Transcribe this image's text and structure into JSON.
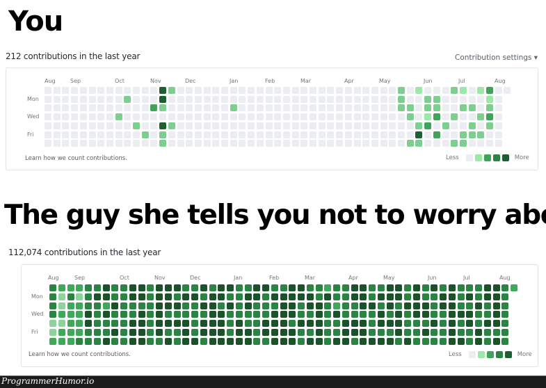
{
  "captions": {
    "top": "You",
    "bottom": "The guy she tells you not to worry about"
  },
  "palette": {
    "level0": "#ebedf0",
    "level1": "#9be9a8",
    "level2": "#7dcf8f",
    "level3": "#40a35a",
    "level4": "#1e5e31",
    "dense1": "#8fd39c",
    "dense2": "#3fa85a",
    "dense3": "#2b8444",
    "dense4": "#1b5229"
  },
  "profile1": {
    "count_text": "212 contributions in the last year",
    "settings_label": "Contribution settings ▾",
    "months": [
      "Aug",
      "Sep",
      "Oct",
      "Nov",
      "Dec",
      "Jan",
      "Feb",
      "Mar",
      "Apr",
      "May",
      "Jun",
      "Jul",
      "Aug"
    ],
    "weekdays": [
      "Mon",
      "Wed",
      "Fri"
    ],
    "learn_text": "Learn how we count contributions.",
    "legend_less": "Less",
    "legend_more": "More"
  },
  "profile2": {
    "count_text": "112,074 contributions in the last year",
    "months": [
      "Aug",
      "Sep",
      "Oct",
      "Nov",
      "Dec",
      "Jan",
      "Feb",
      "Mar",
      "Apr",
      "May",
      "Jun",
      "Jul",
      "Aug"
    ],
    "weekdays": [
      "Mon",
      "Wed",
      "Fri"
    ],
    "learn_text": "Learn how we count contributions.",
    "legend_less": "Less",
    "legend_more": "More"
  },
  "watermark": "ProgrammerHumor.io",
  "chart_data": [
    {
      "type": "heatmap",
      "title": "212 contributions in the last year",
      "x_tick_labels": [
        "Aug",
        "Sep",
        "Oct",
        "Nov",
        "Dec",
        "Jan",
        "Feb",
        "Mar",
        "Apr",
        "May",
        "Jun",
        "Jul",
        "Aug"
      ],
      "y_tick_labels": [
        "Mon",
        "Wed",
        "Fri"
      ],
      "rows": [
        "Sun",
        "Mon",
        "Tue",
        "Wed",
        "Thu",
        "Fri",
        "Sat"
      ],
      "weeks": 53,
      "levels_legend": [
        "Less",
        "More"
      ],
      "nonzero_cells": [
        {
          "row": 0,
          "week": 13,
          "level": 4
        },
        {
          "row": 0,
          "week": 14,
          "level": 2
        },
        {
          "row": 0,
          "week": 40,
          "level": 2
        },
        {
          "row": 0,
          "week": 42,
          "level": 1
        },
        {
          "row": 0,
          "week": 46,
          "level": 2
        },
        {
          "row": 0,
          "week": 47,
          "level": 1
        },
        {
          "row": 0,
          "week": 49,
          "level": 1
        },
        {
          "row": 0,
          "week": 50,
          "level": 3
        },
        {
          "row": 1,
          "week": 9,
          "level": 2
        },
        {
          "row": 1,
          "week": 13,
          "level": 4
        },
        {
          "row": 1,
          "week": 40,
          "level": 2
        },
        {
          "row": 1,
          "week": 43,
          "level": 2
        },
        {
          "row": 1,
          "week": 44,
          "level": 2
        },
        {
          "row": 1,
          "week": 50,
          "level": 1
        },
        {
          "row": 2,
          "week": 12,
          "level": 3
        },
        {
          "row": 2,
          "week": 13,
          "level": 2
        },
        {
          "row": 2,
          "week": 21,
          "level": 2
        },
        {
          "row": 2,
          "week": 40,
          "level": 2
        },
        {
          "row": 2,
          "week": 41,
          "level": 2
        },
        {
          "row": 2,
          "week": 43,
          "level": 2
        },
        {
          "row": 2,
          "week": 44,
          "level": 2
        },
        {
          "row": 2,
          "week": 47,
          "level": 2
        },
        {
          "row": 2,
          "week": 48,
          "level": 2
        },
        {
          "row": 2,
          "week": 50,
          "level": 2
        },
        {
          "row": 3,
          "week": 8,
          "level": 2
        },
        {
          "row": 3,
          "week": 41,
          "level": 2
        },
        {
          "row": 3,
          "week": 43,
          "level": 1
        },
        {
          "row": 3,
          "week": 44,
          "level": 3
        },
        {
          "row": 3,
          "week": 46,
          "level": 2
        },
        {
          "row": 3,
          "week": 49,
          "level": 2
        },
        {
          "row": 3,
          "week": 50,
          "level": 3
        },
        {
          "row": 4,
          "week": 10,
          "level": 2
        },
        {
          "row": 4,
          "week": 13,
          "level": 4
        },
        {
          "row": 4,
          "week": 14,
          "level": 2
        },
        {
          "row": 4,
          "week": 42,
          "level": 2
        },
        {
          "row": 4,
          "week": 43,
          "level": 3
        },
        {
          "row": 4,
          "week": 45,
          "level": 2
        },
        {
          "row": 4,
          "week": 48,
          "level": 2
        },
        {
          "row": 4,
          "week": 50,
          "level": 2
        },
        {
          "row": 5,
          "week": 11,
          "level": 2
        },
        {
          "row": 5,
          "week": 13,
          "level": 2
        },
        {
          "row": 5,
          "week": 42,
          "level": 4
        },
        {
          "row": 5,
          "week": 44,
          "level": 3
        },
        {
          "row": 5,
          "week": 47,
          "level": 2
        },
        {
          "row": 5,
          "week": 48,
          "level": 2
        },
        {
          "row": 5,
          "week": 49,
          "level": 2
        },
        {
          "row": 6,
          "week": 13,
          "level": 2
        },
        {
          "row": 6,
          "week": 41,
          "level": 2
        },
        {
          "row": 6,
          "week": 42,
          "level": 2
        },
        {
          "row": 6,
          "week": 46,
          "level": 2
        },
        {
          "row": 6,
          "week": 47,
          "level": 2
        }
      ]
    },
    {
      "type": "heatmap",
      "title": "112,074 contributions in the last year",
      "x_tick_labels": [
        "Aug",
        "Sep",
        "Oct",
        "Nov",
        "Dec",
        "Jan",
        "Feb",
        "Mar",
        "Apr",
        "May",
        "Jun",
        "Jul",
        "Aug"
      ],
      "y_tick_labels": [
        "Mon",
        "Wed",
        "Fri"
      ],
      "rows": [
        "Sun",
        "Mon",
        "Tue",
        "Wed",
        "Thu",
        "Fri",
        "Sat"
      ],
      "weeks": 53,
      "levels_legend": [
        "Less",
        "More"
      ],
      "grid_levels": [
        "32223343344344433434433443344332334433443434343334432",
        "31313443344344344344334434444434334434443433443434432",
        "31223324333344433443434333443443233443434443443343432",
        "32224343334343333344333334443343433334343443344433432",
        "11224333344344443444343344434443344434443334343434432",
        "12223334344343343444344344443343344433343343343343332",
        "22233343344334344344444334443443443444434333344343432"
      ]
    }
  ]
}
